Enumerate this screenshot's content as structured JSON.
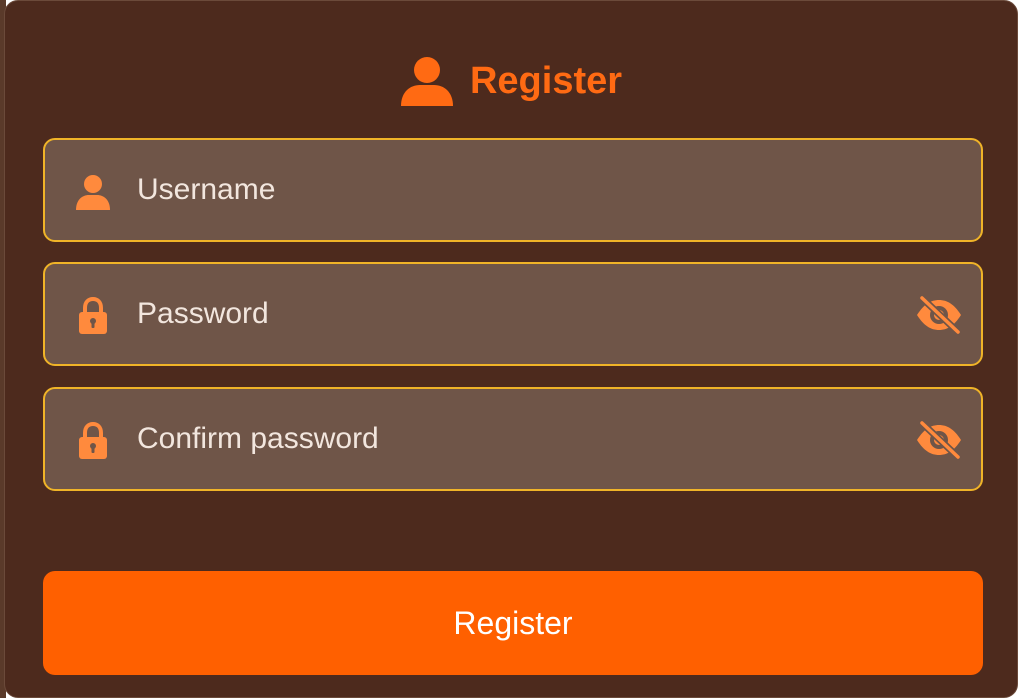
{
  "colors": {
    "card_background": "#4d2a1d",
    "accent": "#ff6a13",
    "button": "#ff6000",
    "field_background": "#6f5548",
    "field_border": "#f0b428",
    "field_icon": "#ff8a3d"
  },
  "header": {
    "icon": "user-icon",
    "title": "Register"
  },
  "form": {
    "username": {
      "icon": "user-icon",
      "placeholder": "Username",
      "value": ""
    },
    "password": {
      "icon": "lock-icon",
      "placeholder": "Password",
      "value": "",
      "toggle_icon": "eye-slash-icon"
    },
    "confirm_password": {
      "icon": "lock-icon",
      "placeholder": "Confirm password",
      "value": "",
      "toggle_icon": "eye-slash-icon"
    },
    "submit_label": "Register"
  }
}
